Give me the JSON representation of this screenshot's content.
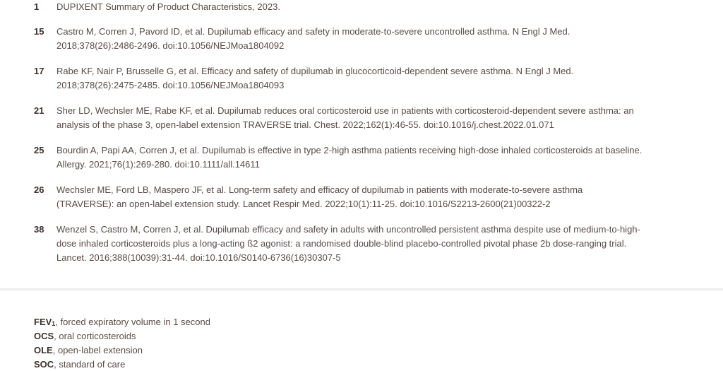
{
  "references": [
    {
      "number": "1",
      "text": "DUPIXENT Summary of Product Characteristics, 2023."
    },
    {
      "number": "15",
      "text": "Castro M, Corren J, Pavord ID, et al. Dupilumab efficacy and safety in moderate-to-severe uncontrolled asthma. N Engl J Med. 2018;378(26):2486-2496. doi:10.1056/NEJMoa1804092"
    },
    {
      "number": "17",
      "text": "Rabe KF, Nair P, Brusselle G, et al. Efficacy and safety of dupilumab in glucocorticoid-dependent severe asthma. N Engl J Med. 2018;378(26):2475-2485. doi:10.1056/NEJMoa1804093"
    },
    {
      "number": "21",
      "text": "Sher LD, Wechsler ME, Rabe KF, et al. Dupilumab reduces oral corticosteroid use in patients with corticosteroid-dependent severe asthma: an analysis of the phase 3, open-label extension TRAVERSE trial. Chest. 2022;162(1):46-55. doi:10.1016/j.chest.2022.01.071"
    },
    {
      "number": "25",
      "text": "Bourdin A, Papi AA, Corren J, et al. Dupilumab is effective in type 2-high asthma patients receiving high-dose inhaled corticosteroids at baseline. Allergy. 2021;76(1):269-280. doi:10.1111/all.14611"
    },
    {
      "number": "26",
      "text": "Wechsler ME, Ford LB, Maspero JF, et al. Long-term safety and efficacy of dupilumab in patients with moderate-to-severe asthma (TRAVERSE): an open-label extension study. Lancet Respir Med. 2022;10(1):11-25. doi:10.1016/S2213-2600(21)00322-2"
    },
    {
      "number": "38",
      "text": "Wenzel S, Castro M, Corren J, et al. Dupilumab efficacy and safety in adults with uncontrolled persistent asthma despite use of medium-to-high-dose inhaled corticosteroids plus a long-acting ß2 agonist: a randomised double-blind placebo-controlled pivotal phase 2b dose-ranging trial. Lancet. 2016;388(10039):31-44. doi:10.1016/S0140-6736(16)30307-5"
    }
  ],
  "abbreviations": [
    {
      "term": "FEV",
      "term_sub": "1",
      "definition": ", forced expiratory volume in 1 second"
    },
    {
      "term": "OCS",
      "term_sub": "",
      "definition": ", oral corticosteroids"
    },
    {
      "term": "OLE",
      "term_sub": "",
      "definition": ", open-label extension"
    },
    {
      "term": "SOC",
      "term_sub": "",
      "definition": ", standard of care"
    }
  ]
}
